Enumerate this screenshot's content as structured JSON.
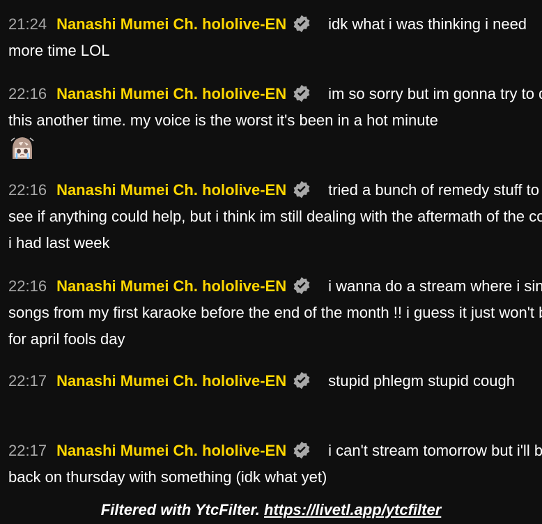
{
  "messages": [
    {
      "time": "21:24",
      "author": "Nanashi Mumei Ch. hololive-EN",
      "badge": "verified-icon",
      "text": "idk what i was thinking i need more time LOL"
    },
    {
      "time": "22:16",
      "author": "Nanashi Mumei Ch. hololive-EN",
      "badge": "verified-icon",
      "text": "im so sorry but im gonna try to do this another time. my voice is the worst it's been in a hot minute",
      "emoji": "crying-mumei-emoji"
    },
    {
      "time": "22:16",
      "author": "Nanashi Mumei Ch. hololive-EN",
      "badge": "verified-icon",
      "text": "tried a bunch of remedy stuff to see if anything could help, but i think im still dealing with the aftermath of the cold i had last week"
    },
    {
      "time": "22:16",
      "author": "Nanashi Mumei Ch. hololive-EN",
      "badge": "verified-icon",
      "text": "i wanna do a stream where i sing songs from my first karaoke before the end of the month !! i guess it just won't be for april fools day"
    },
    {
      "time": "22:17",
      "author": "Nanashi Mumei Ch. hololive-EN",
      "badge": "verified-icon",
      "text": "stupid phlegm stupid cough"
    },
    {
      "time": "22:17",
      "author": "Nanashi Mumei Ch. hololive-EN",
      "badge": "verified-icon",
      "text": "i can't stream tomorrow but i'll be back on thursday with something (idk what yet)"
    }
  ],
  "footer": {
    "label": "Filtered with YtcFilter.",
    "link": "https://livetl.app/ytcfilter"
  },
  "colors": {
    "background": "#0f0f0f",
    "author": "#ffd600",
    "timestamp": "#a9a9a9",
    "text": "#ffffff"
  }
}
